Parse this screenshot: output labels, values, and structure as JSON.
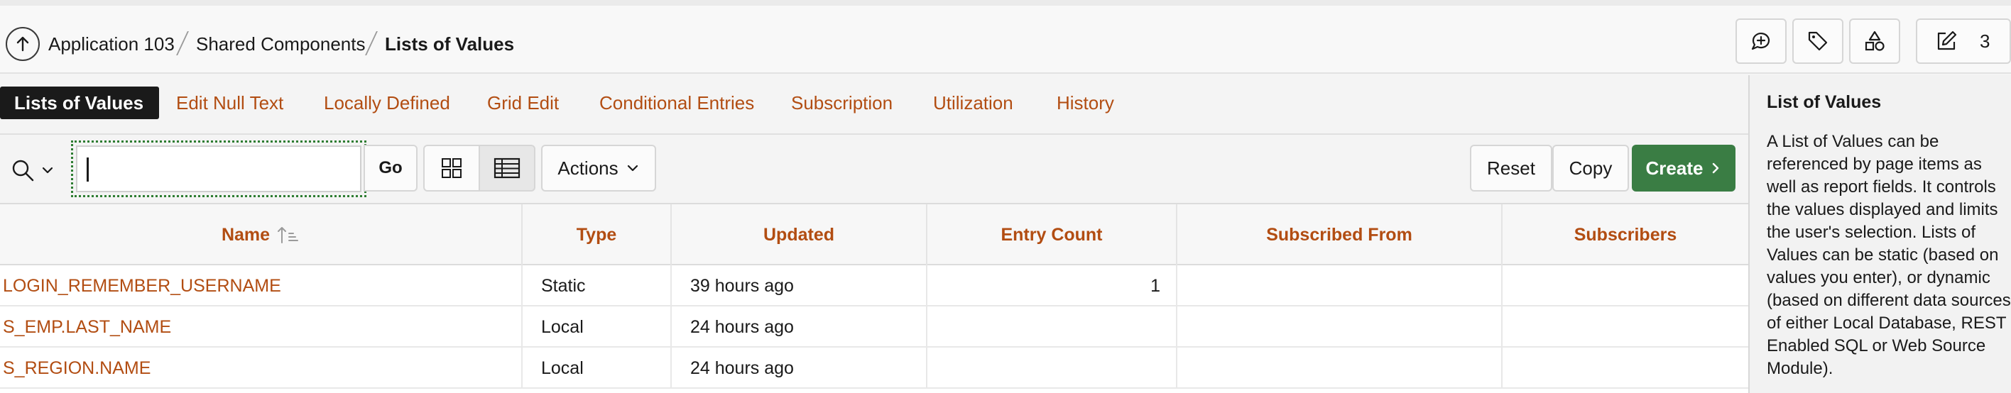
{
  "breadcrumb": {
    "items": [
      "Application 103",
      "Shared Components",
      "Lists of Values"
    ]
  },
  "header": {
    "icons": [
      "up-arrow-icon",
      "comment-add-icon",
      "tag-icon",
      "shapes-icon",
      "edit-icon"
    ],
    "edit_count": "3"
  },
  "tabs": [
    {
      "label": "Lists of Values",
      "active": true
    },
    {
      "label": "Edit Null Text"
    },
    {
      "label": "Locally Defined"
    },
    {
      "label": "Grid Edit"
    },
    {
      "label": "Conditional Entries"
    },
    {
      "label": "Subscription"
    },
    {
      "label": "Utilization"
    },
    {
      "label": "History"
    }
  ],
  "toolbar": {
    "search_value": "",
    "go_label": "Go",
    "actions_label": "Actions",
    "reset_label": "Reset",
    "copy_label": "Copy",
    "create_label": "Create"
  },
  "table": {
    "columns": [
      "Name",
      "Type",
      "Updated",
      "Entry Count",
      "Subscribed From",
      "Subscribers"
    ],
    "rows": [
      [
        "LOGIN_REMEMBER_USERNAME",
        "Static",
        "39 hours ago",
        "1",
        "",
        ""
      ],
      [
        "S_EMP.LAST_NAME",
        "Local",
        "24 hours ago",
        "",
        "",
        ""
      ],
      [
        "S_REGION.NAME",
        "Local",
        "24 hours ago",
        "",
        "",
        ""
      ]
    ]
  },
  "panel": {
    "title": "List of Values",
    "body": "A List of Values can be\nreferenced by page items as\nwell as report fields. It controls\nthe values displayed and limits\nthe user's selection. Lists of\nValues can be static (based on\nvalues you enter), or dynamic\n(based on different data sources\nof either Local Database, REST\nEnabled SQL or Web Source\nModule)."
  },
  "colors": {
    "link": "#b24d12",
    "create": "#3a7d44",
    "active_tab": "#1a1a1a"
  }
}
